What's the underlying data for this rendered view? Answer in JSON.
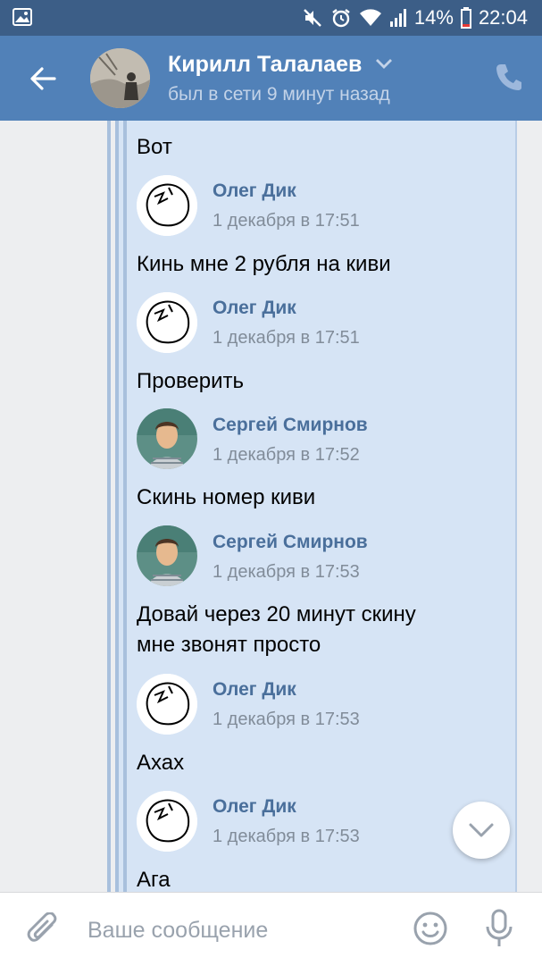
{
  "status_bar": {
    "battery_percent": "14%",
    "time": "22:04",
    "icons": [
      "gallery-icon",
      "mute-icon",
      "alarm-icon",
      "wifi-icon",
      "signal-icon",
      "battery-icon"
    ]
  },
  "header": {
    "name": "Кирилл Талалаев",
    "status": "был в сети 9 минут назад",
    "icons": [
      "back-arrow-icon",
      "chevron-down-icon",
      "phone-icon"
    ]
  },
  "messages": [
    {
      "text": "Вот"
    },
    {
      "sender": "Олег Дик",
      "time": "1 декабря в 17:51",
      "text": "Кинь мне 2 рубля на киви"
    },
    {
      "sender": "Олег Дик",
      "time": "1 декабря в 17:51",
      "text": "Проверить"
    },
    {
      "sender": "Сергей Смирнов",
      "time": "1 декабря в 17:52",
      "text": "Скинь номер киви"
    },
    {
      "sender": "Сергей Смирнов",
      "time": "1 декабря в 17:53",
      "text_lines": [
        "Довай через 20 минут скину",
        "мне звонят просто"
      ]
    },
    {
      "sender": "Олег Дик",
      "time": "1 декабря в 17:53",
      "text": "Ахах"
    },
    {
      "sender": "Олег Дик",
      "time": "1 декабря в 17:53",
      "text": "Ага"
    }
  ],
  "composer": {
    "placeholder": "Ваше сообщение",
    "icons": [
      "attach-icon",
      "emoji-icon",
      "microphone-icon"
    ]
  },
  "colors": {
    "header_bg": "#5181b8",
    "status_bar_bg": "#3c5e87",
    "bubble_bg": "#d6e4f5",
    "sender_name": "#4a6f9b"
  }
}
